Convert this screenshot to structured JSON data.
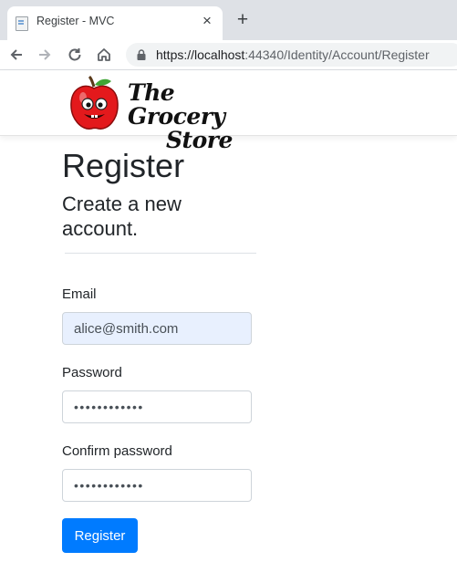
{
  "browser": {
    "tab_title": "Register - MVC",
    "tab_close": "×",
    "new_tab": "+",
    "url_host": "https://localhost",
    "url_rest": ":44340/Identity/Account/Register"
  },
  "site": {
    "logo_line1": "The Grocery",
    "logo_line2": "Store"
  },
  "page": {
    "title": "Register",
    "subtitle": "Create a new account.",
    "email_label": "Email",
    "email_value": "alice@smith.com",
    "password_label": "Password",
    "password_value": "••••••••••••",
    "confirm_label": "Confirm password",
    "confirm_value": "••••••••••••",
    "submit_label": "Register"
  },
  "colors": {
    "accent": "#007bff",
    "autofill": "#e8f0fe"
  }
}
